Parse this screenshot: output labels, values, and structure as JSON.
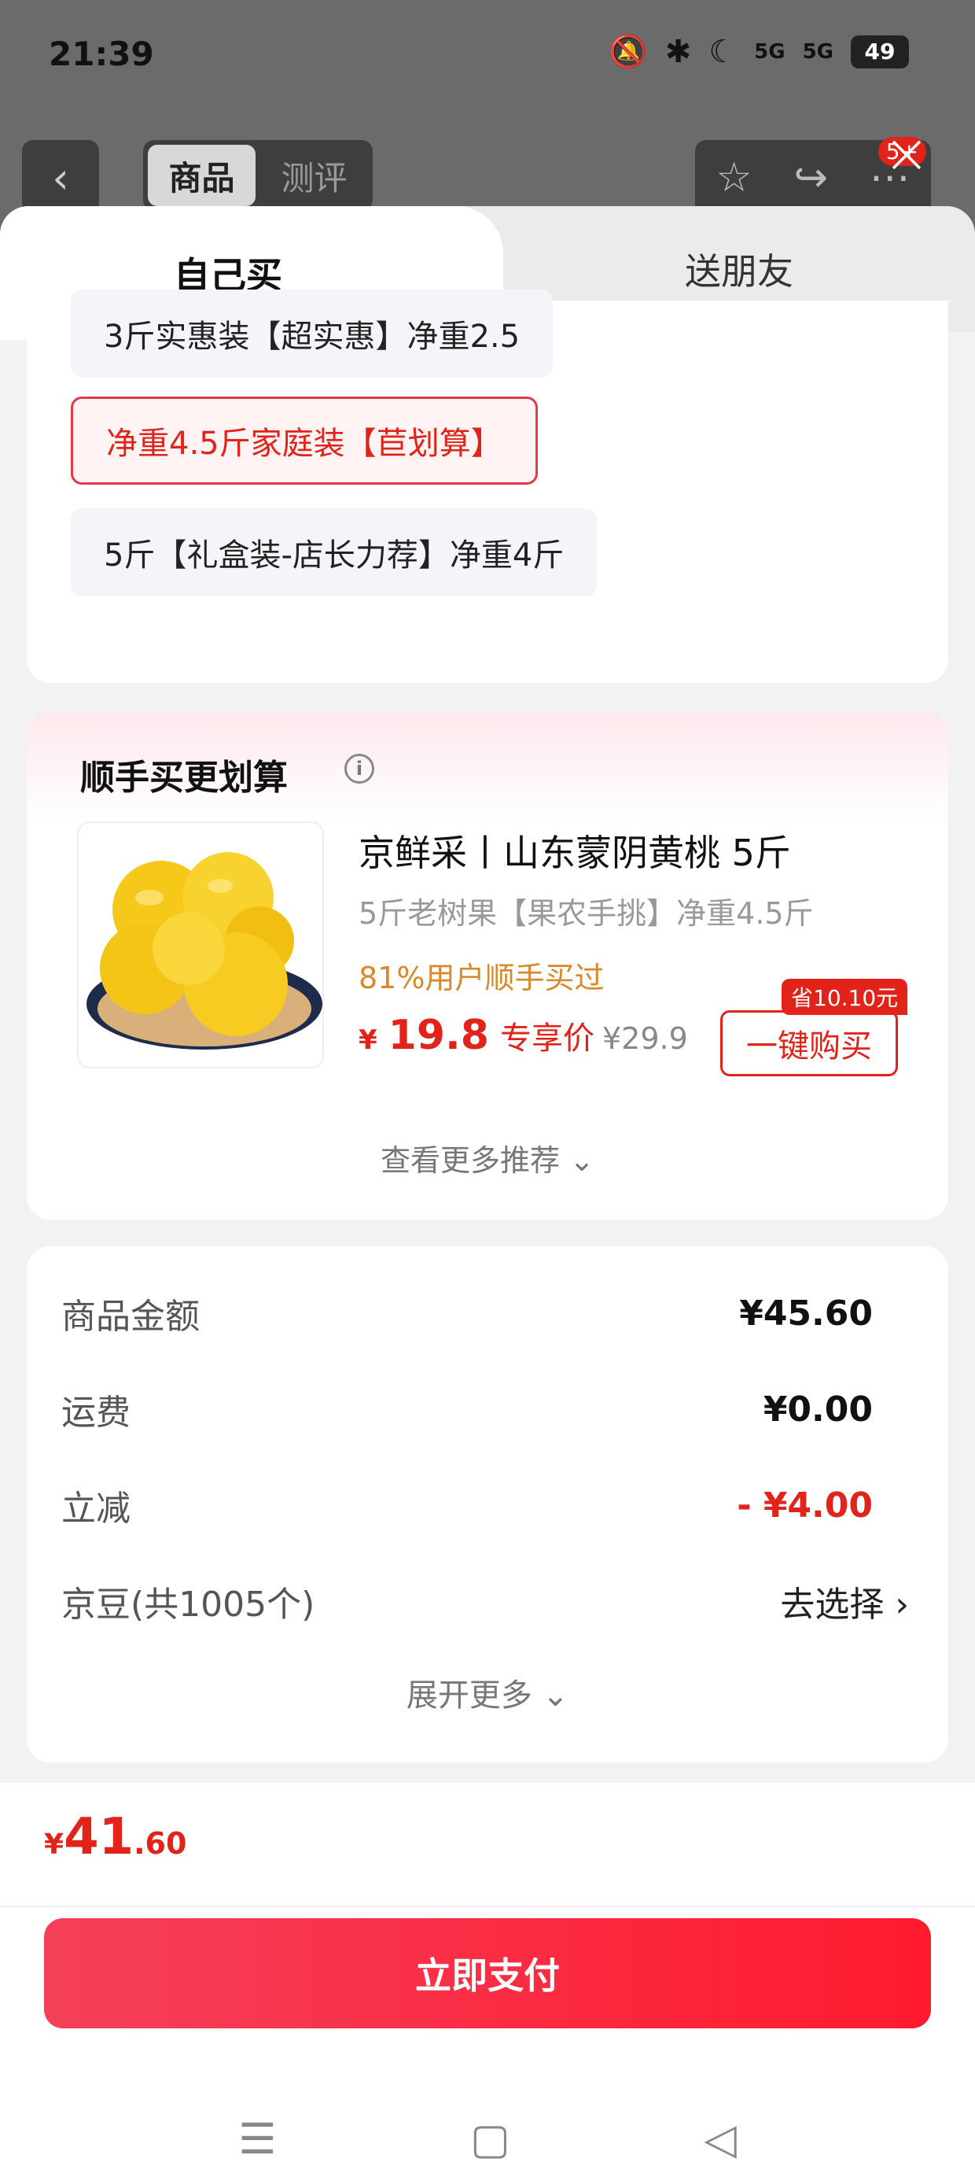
{
  "status_bar": {
    "time": "21:39",
    "signal1": "5G",
    "signal2": "5G",
    "battery": "49"
  },
  "background_page": {
    "tabs": [
      "商品",
      "测评"
    ],
    "badge": "5+"
  },
  "sheet": {
    "tabs": {
      "self": "自己买",
      "friend": "送朋友"
    },
    "specs": [
      {
        "label": "3斤实惠装【超实惠】净重2.5",
        "selected": false
      },
      {
        "label": "净重4.5斤家庭装【苣划算】",
        "selected": true
      },
      {
        "label": "5斤【礼盒装-店长力荐】净重4斤",
        "selected": false
      }
    ],
    "recommend": {
      "title": "顺手买更划算",
      "product_name": "京鲜采丨山东蒙阴黄桃 5斤",
      "product_sub": "5斤老树果【果农手挑】净重4.5斤",
      "tag": "81%用户顺手买过",
      "price_yen": "¥",
      "price_int": "19.8",
      "price_label": "专享价",
      "orig_price": "¥29.9",
      "save_badge": "省10.10元",
      "buy_button": "一键购买",
      "more": "查看更多推荐 ⌄"
    },
    "summary": {
      "rows": [
        {
          "label": "商品金额",
          "value": "¥45.60"
        },
        {
          "label": "运费",
          "value": "¥0.00"
        },
        {
          "label": "立减",
          "value": "- ¥4.00"
        },
        {
          "label": "京豆(共1005个)",
          "value": "去选择 ›"
        }
      ],
      "expand": "展开更多 ⌄"
    }
  },
  "footer": {
    "total_yen": "¥",
    "total_int": "41",
    "total_dec": ".60",
    "pay_button": "立即支付"
  },
  "colors": {
    "accent_red": "#e2231a",
    "tag_orange": "#d9892b"
  }
}
